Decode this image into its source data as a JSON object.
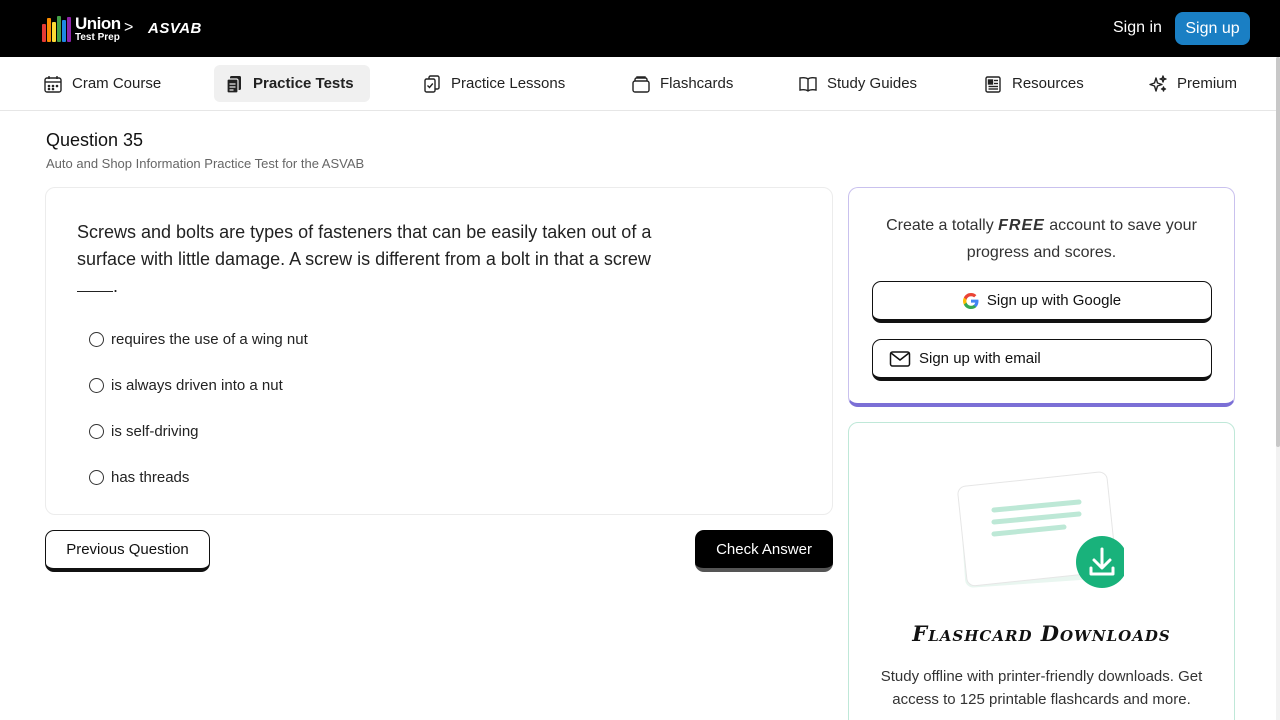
{
  "header": {
    "logo_line1": "Union",
    "logo_line2": "Test Prep",
    "breadcrumb_sep": ">",
    "breadcrumb": "ASVAB",
    "sign_in": "Sign in",
    "sign_up": "Sign up",
    "logo_colors": [
      "#e53935",
      "#fb8c00",
      "#fdd835",
      "#43a047",
      "#1e88e5",
      "#8e24aa",
      "#00acc1"
    ]
  },
  "nav": {
    "items": [
      {
        "label": "Cram Course",
        "icon": "calendar-icon"
      },
      {
        "label": "Practice Tests",
        "icon": "documents-icon"
      },
      {
        "label": "Practice Lessons",
        "icon": "clipboard-check-icon"
      },
      {
        "label": "Flashcards",
        "icon": "card-stack-icon"
      },
      {
        "label": "Study Guides",
        "icon": "open-book-icon"
      },
      {
        "label": "Resources",
        "icon": "newspaper-icon"
      },
      {
        "label": "Premium",
        "icon": "sparkles-icon"
      }
    ],
    "active": "Practice Tests"
  },
  "question": {
    "title": "Question 35",
    "subtitle": "Auto and Shop Information Practice Test for the ASVAB",
    "text": "Screws and bolts are types of fasteners that can be easily taken out of a surface with little damage. A screw is different from a bolt in that a screw",
    "text_end": ".",
    "options": [
      "requires the use of a wing nut",
      "is always driven into a nut",
      "is self-driving",
      "has threads"
    ],
    "prev_label": "Previous Question",
    "check_label": "Check Answer"
  },
  "signup_card": {
    "text_before": "Create a totally ",
    "text_free": "FREE",
    "text_after": " account to save your progress and scores.",
    "google_label": "Sign up with Google",
    "email_label": "Sign up with email"
  },
  "flashcard_card": {
    "title": "Flashcard Downloads",
    "text": "Study offline with printer-friendly downloads. Get access to 125 printable flashcards and more."
  },
  "colors": {
    "accent_blue": "#1a7fc4",
    "signup_border": "#7b6fd6",
    "flashcard_green": "#19b27b"
  }
}
